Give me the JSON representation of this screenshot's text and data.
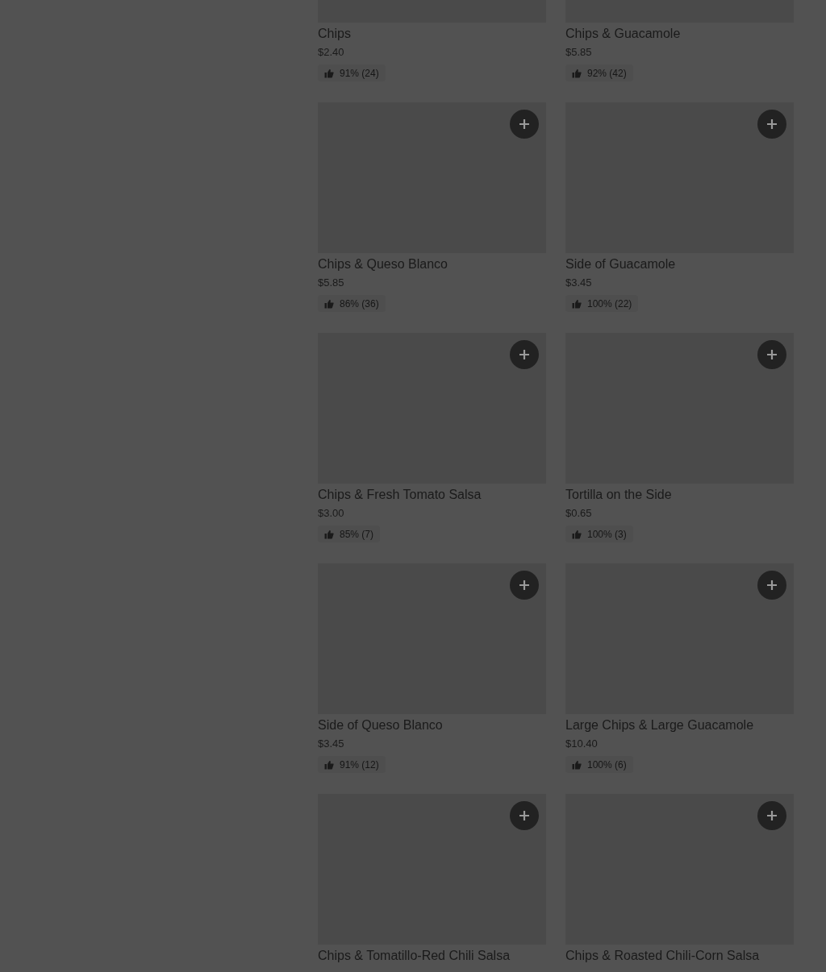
{
  "menu_items": [
    {
      "name": "Chips",
      "price": "$2.40",
      "rating": "91% (24)"
    },
    {
      "name": "Chips & Guacamole",
      "price": "$5.85",
      "rating": "92% (42)"
    },
    {
      "name": "Chips & Queso Blanco",
      "price": "$5.85",
      "rating": "86% (36)"
    },
    {
      "name": "Side of Guacamole",
      "price": "$3.45",
      "rating": "100% (22)"
    },
    {
      "name": "Chips & Fresh Tomato Salsa",
      "price": "$3.00",
      "rating": "85% (7)"
    },
    {
      "name": "Tortilla on the Side",
      "price": "$0.65",
      "rating": "100% (3)"
    },
    {
      "name": "Side of Queso Blanco",
      "price": "$3.45",
      "rating": "91% (12)"
    },
    {
      "name": "Large Chips & Large Guacamole",
      "price": "$10.40",
      "rating": "100% (6)"
    },
    {
      "name": "Chips & Tomatillo-Red Chili Salsa"
    },
    {
      "name": "Chips & Roasted Chili-Corn Salsa"
    }
  ]
}
